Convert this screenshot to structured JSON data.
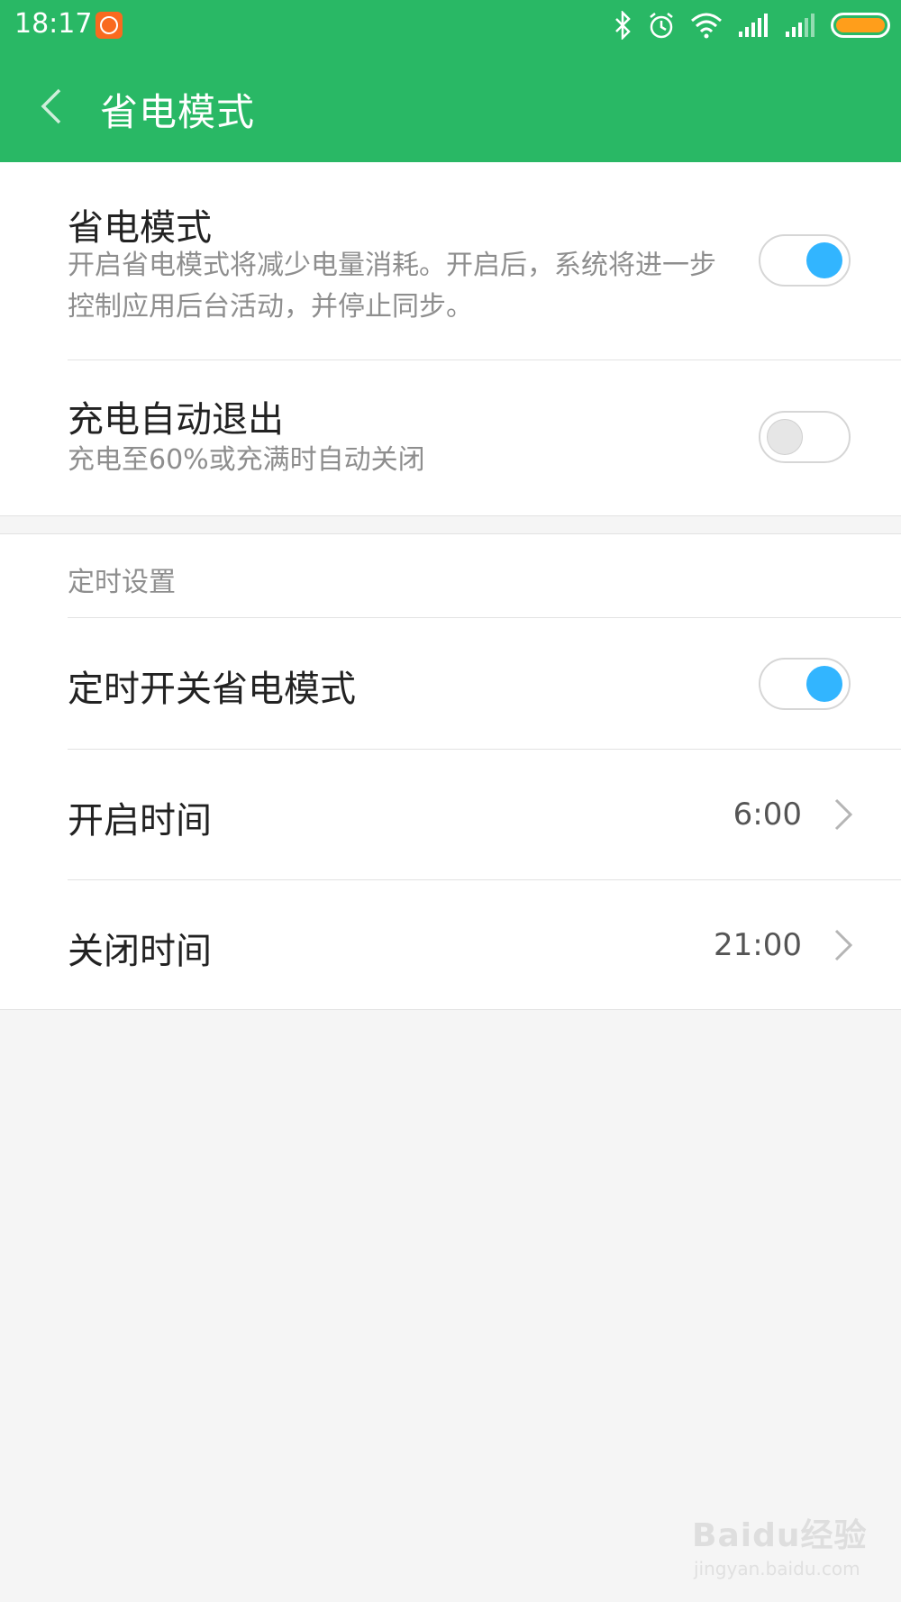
{
  "status_bar": {
    "time": "18:17",
    "icons": [
      "mi-app-icon",
      "bluetooth-icon",
      "alarm-icon",
      "wifi-icon",
      "signal-icon",
      "signal-icon",
      "battery-icon"
    ],
    "battery_color": "#ff9e1b"
  },
  "header": {
    "title": "省电模式",
    "background": "#29b865",
    "back_icon": "chevron-left-icon"
  },
  "power_saving": {
    "title": "省电模式",
    "description": "开启省电模式将减少电量消耗。开启后，系统将进一步控制应用后台活动，并停止同步。",
    "enabled": true
  },
  "auto_exit": {
    "title": "充电自动退出",
    "description": "充电至60%或充满时自动关闭",
    "enabled": false
  },
  "schedule": {
    "section_label": "定时设置",
    "toggle_title": "定时开关省电模式",
    "enabled": true,
    "start": {
      "label": "开启时间",
      "value": "6:00"
    },
    "end": {
      "label": "关闭时间",
      "value": "21:00"
    }
  },
  "colors": {
    "toggle_on": "#32b5ff",
    "toggle_off": "#e6e6e6"
  },
  "watermark": {
    "logo": "Baidu经验",
    "url": "jingyan.baidu.com"
  }
}
